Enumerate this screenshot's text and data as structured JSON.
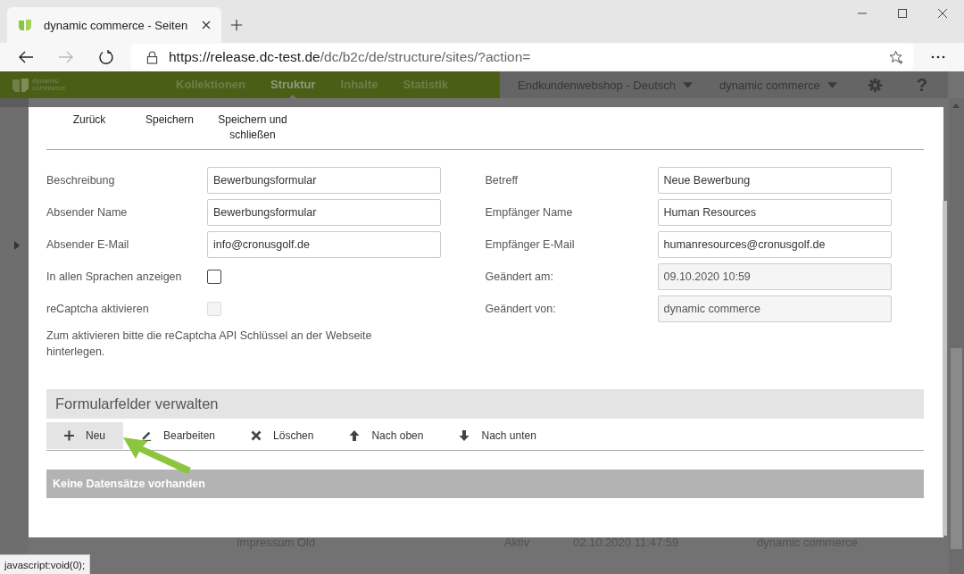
{
  "browser": {
    "tab": {
      "title": "dynamic commerce - Seiten"
    },
    "url_host": "https://release.dc-test.de",
    "url_path": "/dc/b2c/de/structure/sites/?action="
  },
  "app_nav": {
    "logo": [
      "dynamic",
      "commerce"
    ],
    "items": [
      {
        "label": "Kollektionen",
        "selected": false
      },
      {
        "label": "Struktur",
        "selected": true
      },
      {
        "label": "Inhalte",
        "selected": false
      },
      {
        "label": "Statistik",
        "selected": false
      }
    ],
    "shop_select": "Endkundenwebshop - Deutsch",
    "user_select": "dynamic commerce",
    "help": "?"
  },
  "modal": {
    "toolbar": [
      "Zurück",
      "Speichern",
      "Speichern und schließen"
    ],
    "fields_left": [
      {
        "kind": "text",
        "label": "Beschreibung",
        "value": "Bewerbungsformular"
      },
      {
        "kind": "text",
        "label": "Absender Name",
        "value": "Bewerbungsformular"
      },
      {
        "kind": "text",
        "label": "Absender E-Mail",
        "value": "info@cronusgolf.de"
      },
      {
        "kind": "checkbox",
        "label": "In allen Sprachen anzeigen",
        "checked": false,
        "disabled": false
      },
      {
        "kind": "checkbox",
        "label": "reCaptcha aktivieren",
        "checked": false,
        "disabled": true
      }
    ],
    "note": "Zum aktivieren bitte die reCaptcha API Schlüssel an der Webseite hinterlegen.",
    "fields_right": [
      {
        "kind": "text",
        "label": "Betreff",
        "value": "Neue Bewerbung"
      },
      {
        "kind": "text",
        "label": "Empfänger Name",
        "value": "Human Resources"
      },
      {
        "kind": "text",
        "label": "Empfänger E-Mail",
        "value": "humanresources@cronusgolf.de"
      },
      {
        "kind": "readonly",
        "label": "Geändert am:",
        "value": "09.10.2020 10:59"
      },
      {
        "kind": "readonly",
        "label": "Geändert von:",
        "value": "dynamic commerce"
      }
    ],
    "section": {
      "title": "Formularfelder verwalten",
      "actions": [
        {
          "kind": "new",
          "label": "Neu",
          "selected": true
        },
        {
          "kind": "edit",
          "label": "Bearbeiten",
          "selected": false
        },
        {
          "kind": "delete",
          "label": "Löschen",
          "selected": false
        },
        {
          "kind": "up",
          "label": "Nach oben",
          "selected": false
        },
        {
          "kind": "down",
          "label": "Nach unten",
          "selected": false
        }
      ],
      "empty_message": "Keine Datensätze vorhanden"
    }
  },
  "background_row": [
    "Impressum Old",
    "Aktiv",
    "02.10.2020 11:47:59",
    "dynamic commerce"
  ],
  "status_bar": "javascript:void(0);"
}
